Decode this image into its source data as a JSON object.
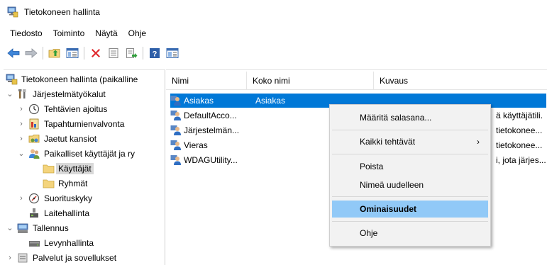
{
  "window": {
    "title": "Tietokoneen hallinta"
  },
  "menu": [
    "Tiedosto",
    "Toiminto",
    "Näytä",
    "Ohje"
  ],
  "toolbar_icons": [
    "back-arrow-icon",
    "forward-arrow-icon",
    "up-folder-icon",
    "show-hide-tree-icon",
    "delete-icon",
    "properties-icon",
    "export-list-icon",
    "help-icon",
    "toggle-pane-icon"
  ],
  "tree": {
    "items": [
      {
        "label": "Tietokoneen hallinta (paikalline",
        "icon": "computer-management-icon"
      },
      {
        "label": "Järjestelmätyökalut",
        "icon": "tools-icon"
      },
      {
        "label": "Tehtävien ajoitus",
        "icon": "clock-icon"
      },
      {
        "label": "Tapahtumienvalvonta",
        "icon": "event-viewer-icon"
      },
      {
        "label": "Jaetut kansiot",
        "icon": "shared-folder-icon"
      },
      {
        "label": "Paikalliset käyttäjät ja ry",
        "icon": "users-icon"
      },
      {
        "label": "Käyttäjät",
        "icon": "folder-icon"
      },
      {
        "label": "Ryhmät",
        "icon": "folder-icon"
      },
      {
        "label": "Suorituskyky",
        "icon": "performance-icon"
      },
      {
        "label": "Laitehallinta",
        "icon": "device-manager-icon"
      },
      {
        "label": "Tallennus",
        "icon": "storage-icon"
      },
      {
        "label": "Levynhallinta",
        "icon": "disk-icon"
      },
      {
        "label": "Palvelut ja sovellukset",
        "icon": "services-icon"
      }
    ]
  },
  "list": {
    "columns": [
      "Nimi",
      "Koko nimi",
      "Kuvaus"
    ],
    "rows": [
      {
        "name": "Asiakas",
        "full_name": "Asiakas",
        "description": ""
      },
      {
        "name": "DefaultAcco...",
        "full_name": "",
        "description": "ä käyttäjätili."
      },
      {
        "name": "Järjestelmän...",
        "full_name": "",
        "description": "tietokonee..."
      },
      {
        "name": "Vieras",
        "full_name": "",
        "description": "tietokonee..."
      },
      {
        "name": "WDAGUtility...",
        "full_name": "",
        "description": "i, jota järjes..."
      }
    ]
  },
  "context_menu": {
    "items": [
      {
        "label": "Määritä salasana..."
      },
      {
        "label": "Kaikki tehtävät",
        "arrow": "›"
      },
      {
        "label": "Poista"
      },
      {
        "label": "Nimeä uudelleen"
      },
      {
        "label": "Ominaisuudet"
      },
      {
        "label": "Ohje"
      }
    ]
  },
  "colors": {
    "selection": "#0078d7",
    "menu_hover": "#91c9f7",
    "menu_bg": "#f2f2f2",
    "folder": "#f4d47c"
  }
}
